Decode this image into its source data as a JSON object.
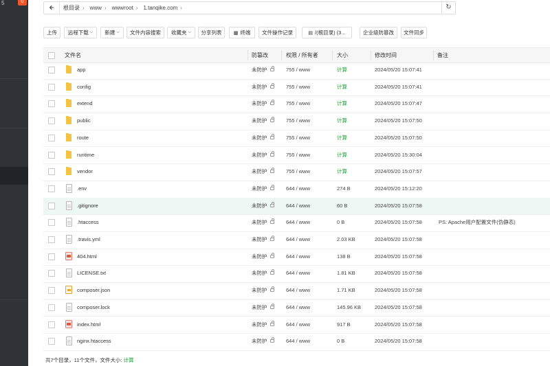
{
  "sidebar": {
    "count_text": "5",
    "badge": "0"
  },
  "path": {
    "back_icon": "arrow-left-icon",
    "crumbs": [
      "根目录",
      "www",
      "wwwroot",
      "1.tanqike.com"
    ],
    "refresh_icon": "refresh-icon"
  },
  "toolbar": {
    "upload": "上传",
    "remote_download": "远程下载",
    "new": "新建",
    "content_search": "文件内容搜索",
    "favorites": "收藏夹",
    "share_list": "分享列表",
    "terminal": "终端",
    "operation_log": "文件操作记录",
    "disk": "/(根目录) (3...",
    "tamper_proof": "企业级防篡改",
    "file_sync": "文件同步"
  },
  "table": {
    "headers": {
      "name": "文件名",
      "protect": "防篡改",
      "perm": "权限 / 所有者",
      "size": "大小",
      "mtime": "修改时间",
      "note": "备注"
    },
    "rows": [
      {
        "name": "app",
        "type": "folder",
        "protect": "未防护",
        "perm": "755 / www",
        "size": "计算",
        "mtime": "2024/05/20 15:07:41",
        "note": ""
      },
      {
        "name": "config",
        "type": "folder",
        "protect": "未防护",
        "perm": "755 / www",
        "size": "计算",
        "mtime": "2024/05/20 15:07:41",
        "note": ""
      },
      {
        "name": "extend",
        "type": "folder",
        "protect": "未防护",
        "perm": "755 / www",
        "size": "计算",
        "mtime": "2024/05/20 15:07:47",
        "note": ""
      },
      {
        "name": "public",
        "type": "folder",
        "protect": "未防护",
        "perm": "755 / www",
        "size": "计算",
        "mtime": "2024/05/20 15:07:50",
        "note": ""
      },
      {
        "name": "route",
        "type": "folder",
        "protect": "未防护",
        "perm": "755 / www",
        "size": "计算",
        "mtime": "2024/05/20 15:07:50",
        "note": ""
      },
      {
        "name": "runtime",
        "type": "folder",
        "protect": "未防护",
        "perm": "755 / www",
        "size": "计算",
        "mtime": "2024/05/20 15:30:04",
        "note": ""
      },
      {
        "name": "vendor",
        "type": "folder",
        "protect": "未防护",
        "perm": "755 / www",
        "size": "计算",
        "mtime": "2024/05/20 15:07:57",
        "note": ""
      },
      {
        "name": ".env",
        "type": "file",
        "protect": "未防护",
        "perm": "644 / www",
        "size": "274 B",
        "mtime": "2024/05/20 15:12:20",
        "note": ""
      },
      {
        "name": ".gitignore",
        "type": "file",
        "protect": "未防护",
        "perm": "644 / www",
        "size": "60 B",
        "mtime": "2024/05/20 15:07:58",
        "note": ""
      },
      {
        "name": ".htaccess",
        "type": "file",
        "protect": "未防护",
        "perm": "644 / www",
        "size": "0 B",
        "mtime": "2024/05/20 15:07:58",
        "note": "PS: Apache用户配置文件(伪静态)"
      },
      {
        "name": ".travis.yml",
        "type": "file",
        "protect": "未防护",
        "perm": "644 / www",
        "size": "2.03 KB",
        "mtime": "2024/05/20 15:07:58",
        "note": ""
      },
      {
        "name": "404.html",
        "type": "html",
        "protect": "未防护",
        "perm": "644 / www",
        "size": "138 B",
        "mtime": "2024/05/20 15:07:58",
        "note": ""
      },
      {
        "name": "LICENSE.txt",
        "type": "file",
        "protect": "未防护",
        "perm": "644 / www",
        "size": "1.81 KB",
        "mtime": "2024/05/20 15:07:58",
        "note": ""
      },
      {
        "name": "composer.json",
        "type": "json",
        "protect": "未防护",
        "perm": "644 / www",
        "size": "1.71 KB",
        "mtime": "2024/05/20 15:07:58",
        "note": ""
      },
      {
        "name": "composer.lock",
        "type": "file",
        "protect": "未防护",
        "perm": "644 / www",
        "size": "145.96 KB",
        "mtime": "2024/05/20 15:07:58",
        "note": ""
      },
      {
        "name": "index.html",
        "type": "html",
        "protect": "未防护",
        "perm": "644 / www",
        "size": "917 B",
        "mtime": "2024/05/20 15:07:58",
        "note": ""
      },
      {
        "name": "nginx.htaccess",
        "type": "file",
        "protect": "未防护",
        "perm": "644 / www",
        "size": "0 B",
        "mtime": "2024/05/20 15:07:58",
        "note": ""
      }
    ]
  },
  "footer": {
    "summary": "共7个目录，11个文件，文件大小: ",
    "calc": "计算"
  },
  "colors": {
    "accent": "#20a53a",
    "sidebar": "#2f3237",
    "badge": "#f0562d",
    "highlight_row": "#edf7f3",
    "folder": "#f5c343"
  }
}
